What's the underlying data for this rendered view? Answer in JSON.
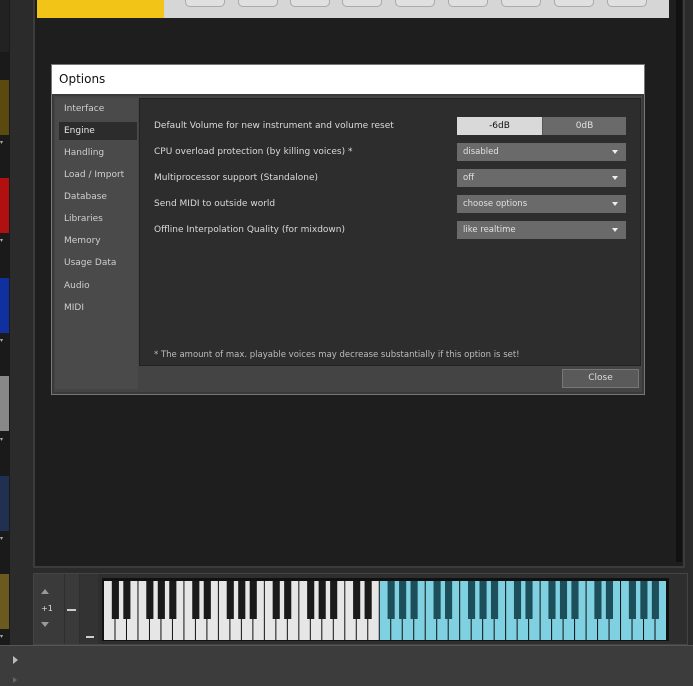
{
  "window": {
    "title": "Options"
  },
  "sidebar": {
    "items": [
      {
        "label": "Interface",
        "active": false
      },
      {
        "label": "Engine",
        "active": true
      },
      {
        "label": "Handling",
        "active": false
      },
      {
        "label": "Load / Import",
        "active": false
      },
      {
        "label": "Database",
        "active": false
      },
      {
        "label": "Libraries",
        "active": false
      },
      {
        "label": "Memory",
        "active": false
      },
      {
        "label": "Usage Data",
        "active": false
      },
      {
        "label": "Audio",
        "active": false
      },
      {
        "label": "MIDI",
        "active": false
      }
    ]
  },
  "engine": {
    "default_volume": {
      "label": "Default Volume for new instrument and volume reset",
      "options": [
        "-6dB",
        "0dB"
      ],
      "selected": "-6dB"
    },
    "cpu_overload": {
      "label": "CPU overload protection (by killing voices) *",
      "value": "disabled"
    },
    "multiprocessor": {
      "label": "Multiprocessor support  (Standalone)",
      "value": "off"
    },
    "send_midi": {
      "label": "Send MIDI to outside world",
      "value": "choose options"
    },
    "offline_quality": {
      "label": "Offline Interpolation Quality (for mixdown)",
      "value": "like realtime"
    },
    "footnote": "* The amount of max. playable voices may decrease substantially if this option is set!"
  },
  "buttons": {
    "close": "Close"
  },
  "keyboard": {
    "octave_shift": "+1",
    "white_key_count": 49,
    "highlight_start_white_key": 24,
    "highlight_color": "#7fd0e0"
  },
  "colors": {
    "accent_yellow": "#f2c417",
    "dialog_title_bg": "#ffffff",
    "panel_bg": "#1e1e1e"
  }
}
